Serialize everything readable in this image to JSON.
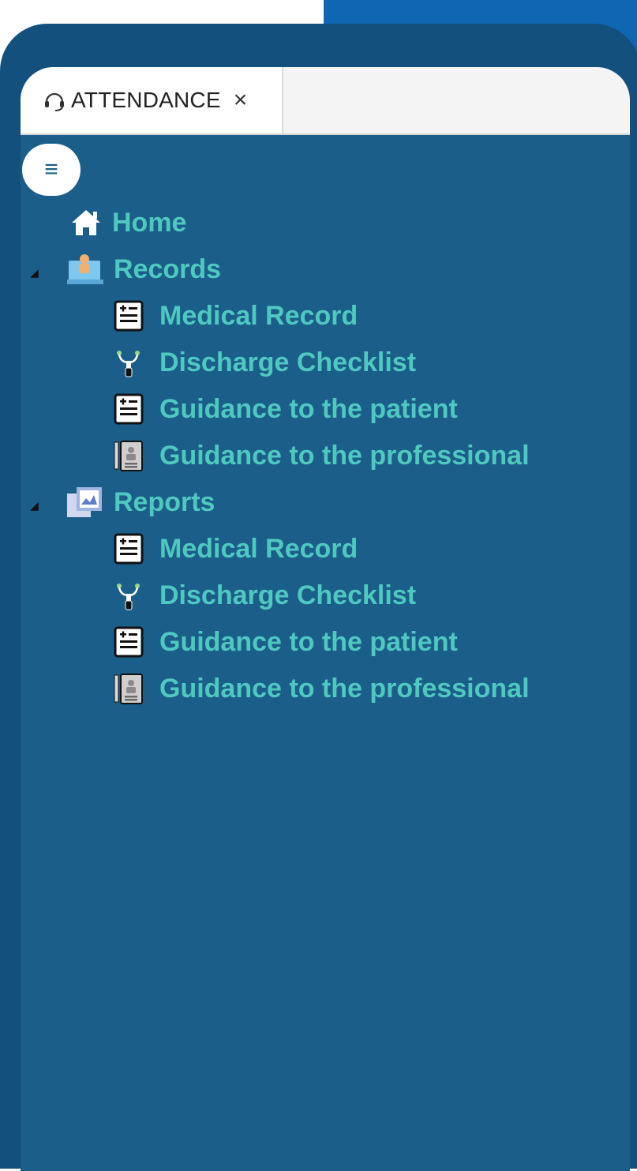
{
  "tab": {
    "label": "ATTENDANCE",
    "close": "×"
  },
  "menu_toggle": "≡",
  "tree": {
    "home": {
      "label": "Home",
      "icon": "home-icon"
    },
    "records": {
      "label": "Records",
      "icon": "records-icon",
      "expander": "◢",
      "children": [
        {
          "label": "Medical Record",
          "icon": "document-icon"
        },
        {
          "label": "Discharge Checklist",
          "icon": "stethoscope-icon"
        },
        {
          "label": "Guidance to the patient",
          "icon": "document-icon"
        },
        {
          "label": "Guidance to the professional",
          "icon": "clipboard-icon"
        }
      ]
    },
    "reports": {
      "label": "Reports",
      "icon": "reports-icon",
      "expander": "◢",
      "children": [
        {
          "label": "Medical Record",
          "icon": "document-icon"
        },
        {
          "label": "Discharge Checklist",
          "icon": "stethoscope-icon"
        },
        {
          "label": "Guidance to the patient",
          "icon": "document-icon"
        },
        {
          "label": "Guidance to the professional",
          "icon": "clipboard-icon"
        }
      ]
    }
  },
  "colors": {
    "device_frame": "#13507d",
    "screen_bg": "#1b5e8a",
    "label_teal": "#4fc9c0",
    "decor_blue": "#0f66b3"
  }
}
